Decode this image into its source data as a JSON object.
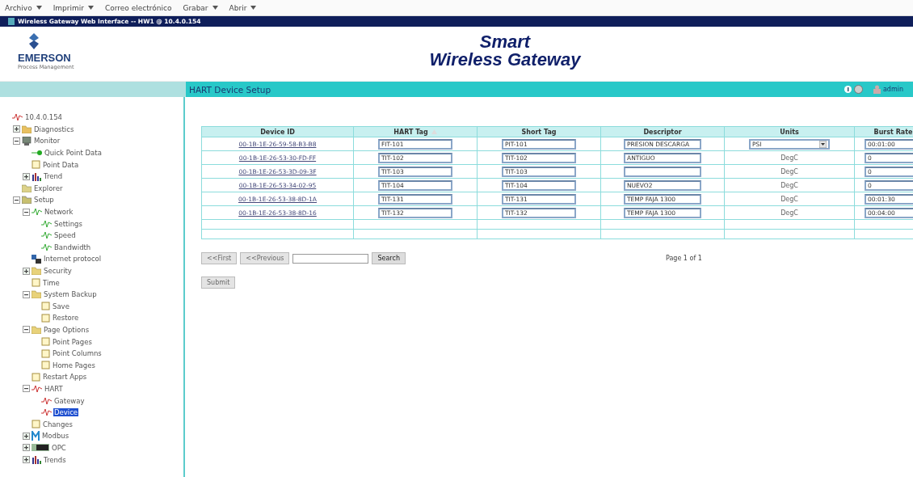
{
  "menu_bar": [
    {
      "label": "Archivo",
      "dropdown": true
    },
    {
      "label": "Imprimir",
      "dropdown": true
    },
    {
      "label": "Correo electrónico",
      "dropdown": false
    },
    {
      "label": "Grabar",
      "dropdown": true
    },
    {
      "label": "Abrir",
      "dropdown": true
    }
  ],
  "window": {
    "title": "Wireless Gateway Web Interface -- HW1 @ 10.4.0.154"
  },
  "header": {
    "logo_name": "EMERSON",
    "logo_tagline": "Process Management",
    "title_line_1": "Smart",
    "title_line_2": "Wireless Gateway",
    "user": "admin"
  },
  "page_title": "HART Device Setup",
  "sidebar": {
    "items": [
      {
        "label": "10.4.0.154",
        "kind": "hart",
        "selected": false,
        "children": [
          {
            "label": "Diagnostics",
            "kind": "diagnostics",
            "selected": false,
            "expanded": false
          },
          {
            "label": "Monitor",
            "kind": "monitor",
            "selected": false,
            "expanded": true,
            "children": [
              {
                "label": "Quick Point Data",
                "kind": "dot",
                "selected": false
              },
              {
                "label": "Point Data",
                "kind": "page",
                "selected": false
              },
              {
                "label": "Trend",
                "kind": "trend",
                "selected": false,
                "expanded": false
              }
            ]
          },
          {
            "label": "Explorer",
            "kind": "explorer",
            "selected": false
          },
          {
            "label": "Setup",
            "kind": "setup",
            "selected": false,
            "expanded": true,
            "children": [
              {
                "label": "Network",
                "kind": "network",
                "selected": false,
                "expanded": true,
                "children": [
                  {
                    "label": "Settings",
                    "kind": "network",
                    "selected": false
                  },
                  {
                    "label": "Speed",
                    "kind": "network",
                    "selected": false
                  },
                  {
                    "label": "Bandwidth",
                    "kind": "network",
                    "selected": false
                  }
                ]
              },
              {
                "label": "Internet protocol",
                "kind": "ip",
                "selected": false
              },
              {
                "label": "Security",
                "kind": "folder",
                "selected": false,
                "expanded": false
              },
              {
                "label": "Time",
                "kind": "page",
                "selected": false
              },
              {
                "label": "System Backup",
                "kind": "folder",
                "selected": false,
                "expanded": true,
                "children": [
                  {
                    "label": "Save",
                    "kind": "page",
                    "selected": false
                  },
                  {
                    "label": "Restore",
                    "kind": "page",
                    "selected": false
                  }
                ]
              },
              {
                "label": "Page Options",
                "kind": "folder",
                "selected": false,
                "expanded": true,
                "children": [
                  {
                    "label": "Point Pages",
                    "kind": "page",
                    "selected": false
                  },
                  {
                    "label": "Point Columns",
                    "kind": "page",
                    "selected": false
                  },
                  {
                    "label": "Home Pages",
                    "kind": "page",
                    "selected": false
                  }
                ]
              },
              {
                "label": "Restart Apps",
                "kind": "page",
                "selected": false
              },
              {
                "label": "HART",
                "kind": "hart",
                "selected": false,
                "expanded": true,
                "children": [
                  {
                    "label": "Gateway",
                    "kind": "hart",
                    "selected": false
                  },
                  {
                    "label": "Device",
                    "kind": "hart",
                    "selected": true
                  }
                ]
              },
              {
                "label": "Changes",
                "kind": "page",
                "selected": false
              },
              {
                "label": "Modbus",
                "kind": "modbus",
                "selected": false,
                "expanded": false
              },
              {
                "label": "OPC",
                "kind": "opc",
                "selected": false,
                "expanded": false
              },
              {
                "label": "Trends",
                "kind": "trend",
                "selected": false,
                "expanded": false
              }
            ]
          }
        ]
      }
    ]
  },
  "table": {
    "columns": [
      {
        "label": "Device ID",
        "sorted": false
      },
      {
        "label": "HART Tag",
        "sorted": true
      },
      {
        "label": "Short Tag",
        "sorted": false
      },
      {
        "label": "Descriptor",
        "sorted": false
      },
      {
        "label": "Units",
        "sorted": false
      },
      {
        "label": "Burst Rate",
        "sorted": false
      }
    ],
    "rows": [
      {
        "device_id": "00-1B-1E-26-59-58-B3-B8",
        "hart_tag": "FIT-101",
        "short_tag": "PIT-101",
        "descriptor": "PRESION DESCARGA",
        "units": {
          "kind": "select",
          "value": "PSI"
        },
        "burst_rate": "00:01:00"
      },
      {
        "device_id": "00-1B-1E-26-53-30-FD-FF",
        "hart_tag": "TIT-102",
        "short_tag": "TIT-102",
        "descriptor": "ANTIGUO",
        "units": {
          "kind": "text",
          "value": "DegC"
        },
        "burst_rate": "0"
      },
      {
        "device_id": "00-1B-1E-26-53-3D-09-3F",
        "hart_tag": "TIT-103",
        "short_tag": "TIT-103",
        "units": {
          "kind": "text",
          "value": "DegC"
        },
        "burst_rate": "0"
      },
      {
        "device_id": "00-1B-1E-26-53-34-02-95",
        "hart_tag": "TIT-104",
        "short_tag": "TIT-104",
        "descriptor": "NUEVO2",
        "units": {
          "kind": "text",
          "value": "DegC"
        },
        "burst_rate": "0"
      },
      {
        "device_id": "00-1B-1E-26-53-38-8D-1A",
        "hart_tag": "TIT-131",
        "short_tag": "TIT-131",
        "descriptor": "TEMP FAJA 1300",
        "units": {
          "kind": "text",
          "value": "DegC"
        },
        "burst_rate": "00:01:30"
      },
      {
        "device_id": "00-1B-1E-26-53-38-8D-16",
        "hart_tag": "TIT-132",
        "short_tag": "TIT-132",
        "descriptor": "TEMP FAJA 1300",
        "units": {
          "kind": "text",
          "value": "DegC"
        },
        "burst_rate": "00:04:00"
      }
    ]
  },
  "pager": {
    "first": {
      "label": "<<First",
      "disabled": true
    },
    "previous": {
      "label": "<<Previous",
      "disabled": true
    },
    "search": {
      "label": "Search",
      "disabled": false
    },
    "status": "Page 1 of 1"
  },
  "submit": {
    "label": "Submit",
    "disabled": true
  }
}
